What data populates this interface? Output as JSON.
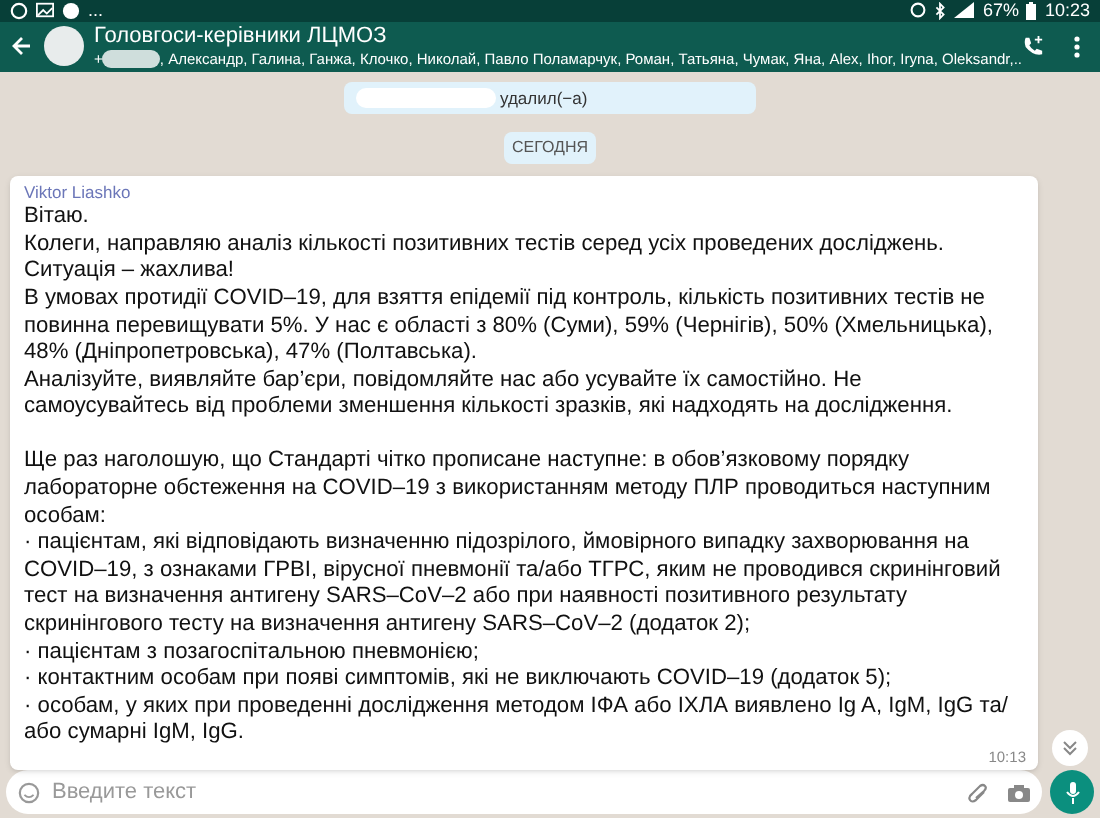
{
  "status_bar": {
    "battery": "67%",
    "time": "10:23",
    "notification_more": "..."
  },
  "header": {
    "title": "Головгоси-керівники ЛЦМОЗ",
    "subtitle_prefix": "+",
    "subtitle": ", Александр, Галина, Ганжа, Клочко, Николай, Павло Поламарчук, Роман, Татьяна, Чумак, Яна, Alex, Ihor, Iryna, Oleksandr,.."
  },
  "system_message": {
    "text": "удалил(−а)"
  },
  "date_chip": "СЕГОДНЯ",
  "message": {
    "sender": "Viktor Liashko",
    "time": "10:13",
    "paragraphs": [
      "Вітаю.",
      "Колеги, направляю аналіз кількості позитивних тестів серед усіх проведених досліджень.",
      "Ситуація – жахлива!",
      "В умовах протидії COVID–19, для взяття епідемії під контроль, кількість позитивних тестів не повинна перевищувати 5%. У нас є області з 80% (Суми), 59% (Чернігів), 50% (Хмельницька), 48% (Дніпропетровська), 47% (Полтавська).",
      "Аналізуйте, виявляйте бар’єри, повідомляйте нас або усувайте їх самостійно. Не самоусувайтесь від проблеми зменшення кількості зразків, які надходять на дослідження."
    ],
    "paragraphs_2": [
      "Ще раз наголошую, що Стандарті чітко прописане наступне: в обов’язковому порядку лабораторне обстеження на COVID–19 з використанням методу ПЛР проводиться наступним особам:",
      "· пацієнтам, які відповідають визначенню підозрілого, ймовірного випадку захворювання на COVID–19, з ознаками ГРВІ, вірусної пневмонії та/або ТГРС, яким не проводився скринінговий тест на визначення антигену SARS–CoV–2 або при наявності позитивного результату скринінгового тесту на визначення антигену SARS–CoV–2 (додаток 2);",
      "· пацієнтам з позагоспітальною пневмонією;",
      "· контактним особам при появі симптомів, які не виключають COVID–19 (додаток 5);",
      "· особам, у яких при проведенні дослідження методом ІФА або ІХЛА виявлено Ig A, IgM, IgG та/або сумарні IgM, IgG."
    ]
  },
  "composer": {
    "placeholder": "Введите текст"
  }
}
